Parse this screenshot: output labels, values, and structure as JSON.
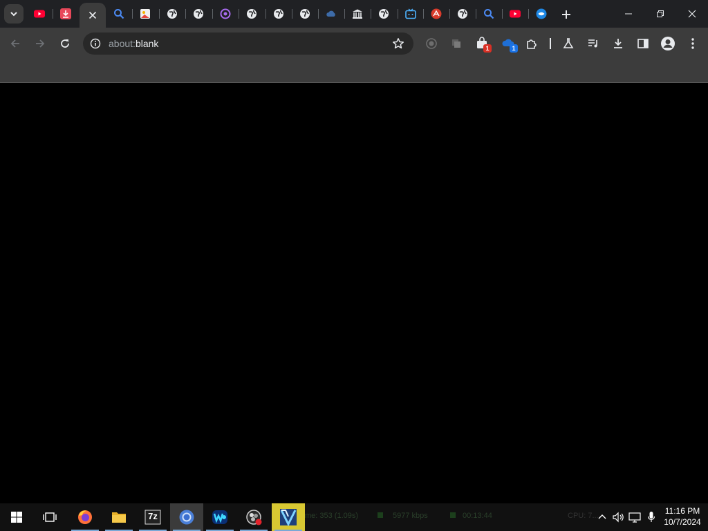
{
  "browser": {
    "omnibox": {
      "url_text": "about:",
      "url_host": "blank"
    },
    "tabs": [
      {
        "icon": "youtube-icon",
        "active": false
      },
      {
        "icon": "pdf-download-icon",
        "active": false
      },
      {
        "icon": "close-icon",
        "active": true
      },
      {
        "icon": "search-icon",
        "active": false
      },
      {
        "icon": "image-icon",
        "active": false
      },
      {
        "icon": "globe-icon",
        "active": false
      },
      {
        "icon": "globe-icon",
        "active": false
      },
      {
        "icon": "purple-ring-icon",
        "active": false
      },
      {
        "icon": "globe-icon",
        "active": false
      },
      {
        "icon": "globe-icon",
        "active": false
      },
      {
        "icon": "globe-icon",
        "active": false
      },
      {
        "icon": "cloud-icon",
        "active": false
      },
      {
        "icon": "museum-icon",
        "active": false
      },
      {
        "icon": "globe-icon",
        "active": false
      },
      {
        "icon": "tv-icon",
        "active": false
      },
      {
        "icon": "red-logo-icon",
        "active": false
      },
      {
        "icon": "globe-icon",
        "active": false
      },
      {
        "icon": "search-icon",
        "active": false
      },
      {
        "icon": "youtube-icon",
        "active": false
      },
      {
        "icon": "blue-app-icon",
        "active": false
      }
    ],
    "extensions": {
      "shopping_badge": "1",
      "cloud_badge": "1"
    },
    "colors": {
      "tabstrip": "#202124",
      "toolbar": "#3c3c3c",
      "omnibox": "#282828",
      "badge_red": "#d93025",
      "badge_blue": "#1a73e8"
    }
  },
  "taskbar": {
    "apps": [
      {
        "name": "Start",
        "icon": "windows-icon"
      },
      {
        "name": "Task View",
        "icon": "task-view-icon"
      },
      {
        "name": "Firefox",
        "icon": "firefox-icon"
      },
      {
        "name": "File Explorer",
        "icon": "folder-icon"
      },
      {
        "name": "7-Zip",
        "icon": "sevenzip-icon",
        "label": "7z"
      },
      {
        "name": "Chrome",
        "icon": "chrome-icon"
      },
      {
        "name": "WebStorm",
        "icon": "webstorm-icon"
      },
      {
        "name": "OBS",
        "icon": "obs-icon"
      },
      {
        "name": "Video Editor",
        "icon": "video-editor-icon"
      }
    ],
    "overlay_stats": {
      "frames": "me: 353 (1.09s)",
      "bitrate": "5977 kbps",
      "time": "00:13:44",
      "cpu": "CPU: 7..."
    },
    "clock": {
      "time": "11:16 PM",
      "date": "10/7/2024"
    }
  }
}
